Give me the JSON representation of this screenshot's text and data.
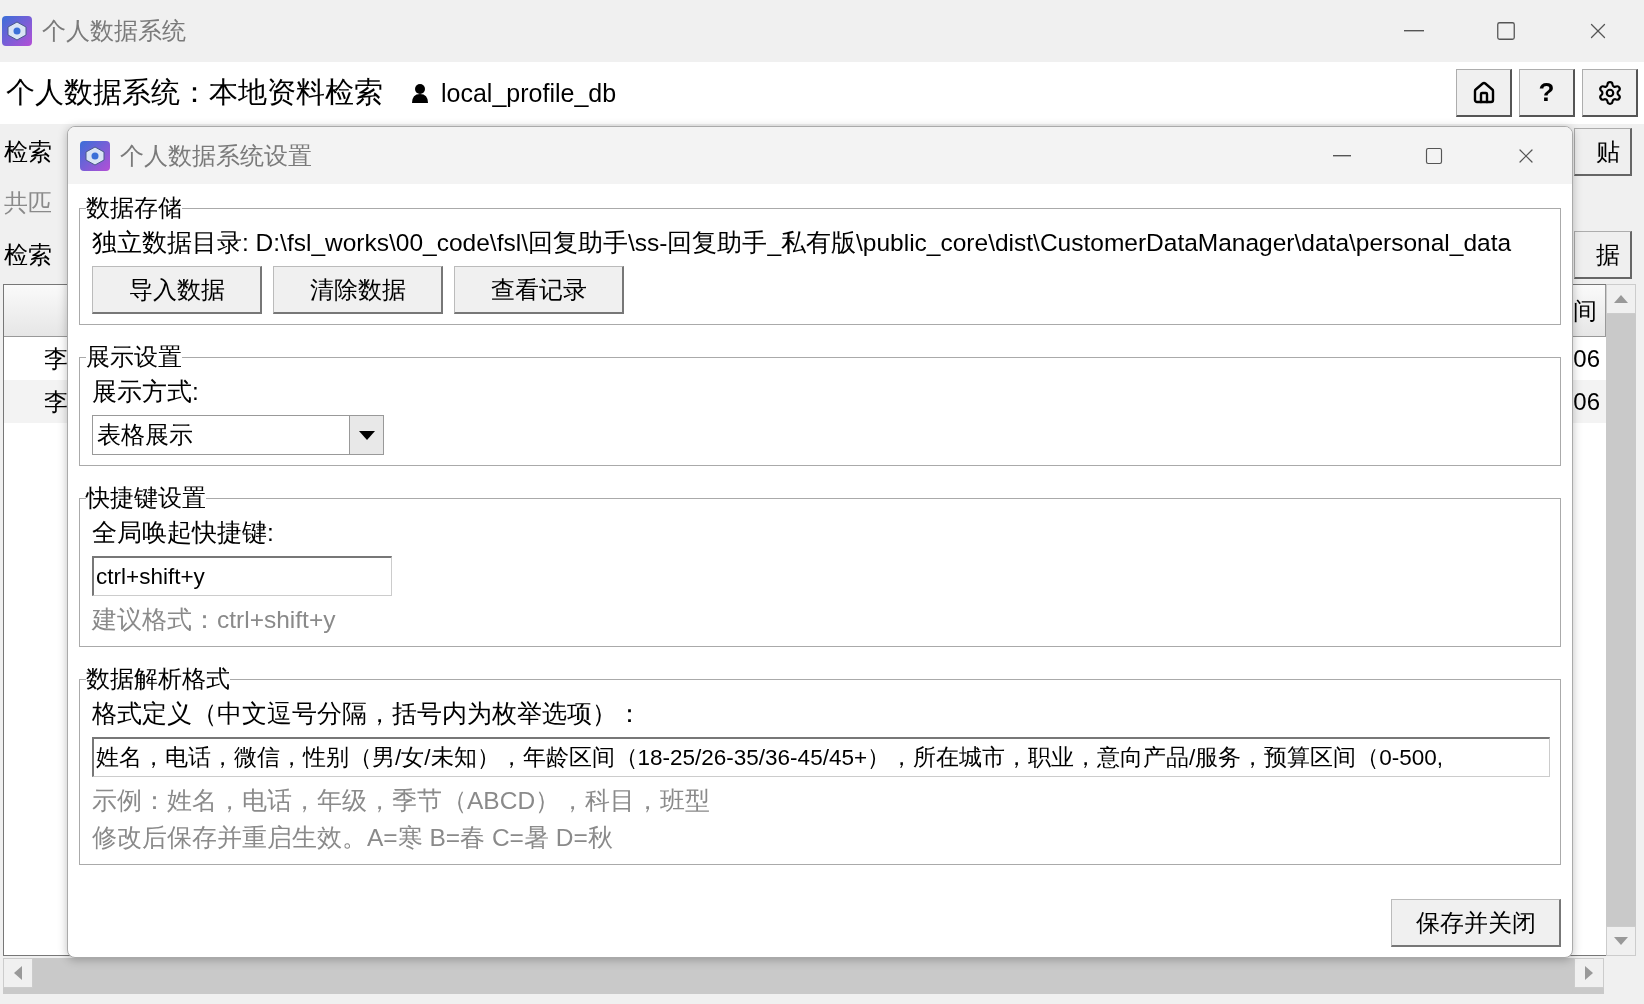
{
  "main_window": {
    "title": "个人数据系统",
    "heading": "个人数据系统：本地资料检索",
    "user": "local_profile_db",
    "help_label": "?",
    "search_label": "检索",
    "match_count": "共匹",
    "results_label": "检索",
    "paste_button": "贴",
    "data_button": "据",
    "table": {
      "columns": [
        "",
        "间"
      ],
      "rows": [
        {
          "column_1": "李",
          "column_2": "06"
        },
        {
          "column_1": "李",
          "column_2": "06"
        }
      ]
    }
  },
  "settings_dialog": {
    "title": "个人数据系统设置",
    "storage": {
      "legend": "数据存储",
      "directory": "独立数据目录: D:\\fsl_works\\00_code\\fsl\\回复助手\\ss-回复助手_私有版\\public_core\\dist\\CustomerDataManager\\data\\personal_data",
      "buttons": [
        "导入数据",
        "清除数据",
        "查看记录"
      ]
    },
    "display": {
      "legend": "展示设置",
      "label": "展示方式:",
      "value": "表格展示"
    },
    "hotkey": {
      "legend": "快捷键设置",
      "label": "全局唤起快捷键:",
      "value": "ctrl+shift+y",
      "hint": "建议格式：ctrl+shift+y"
    },
    "parsing": {
      "legend": "数据解析格式",
      "label": "格式定义（中文逗号分隔，括号内为枚举选项）：",
      "value": "姓名，电话，微信，性别（男/女/未知），年龄区间（18-25/26-35/36-45/45+），所在城市，职业，意向产品/服务，预算区间（0-500,",
      "hints": [
        "示例：姓名，电话，年级，季节（ABCD），科目，班型",
        "修改后保存并重启生效。A=寒 B=春 C=暑 D=秋"
      ]
    },
    "save_button": "保存并关闭"
  }
}
